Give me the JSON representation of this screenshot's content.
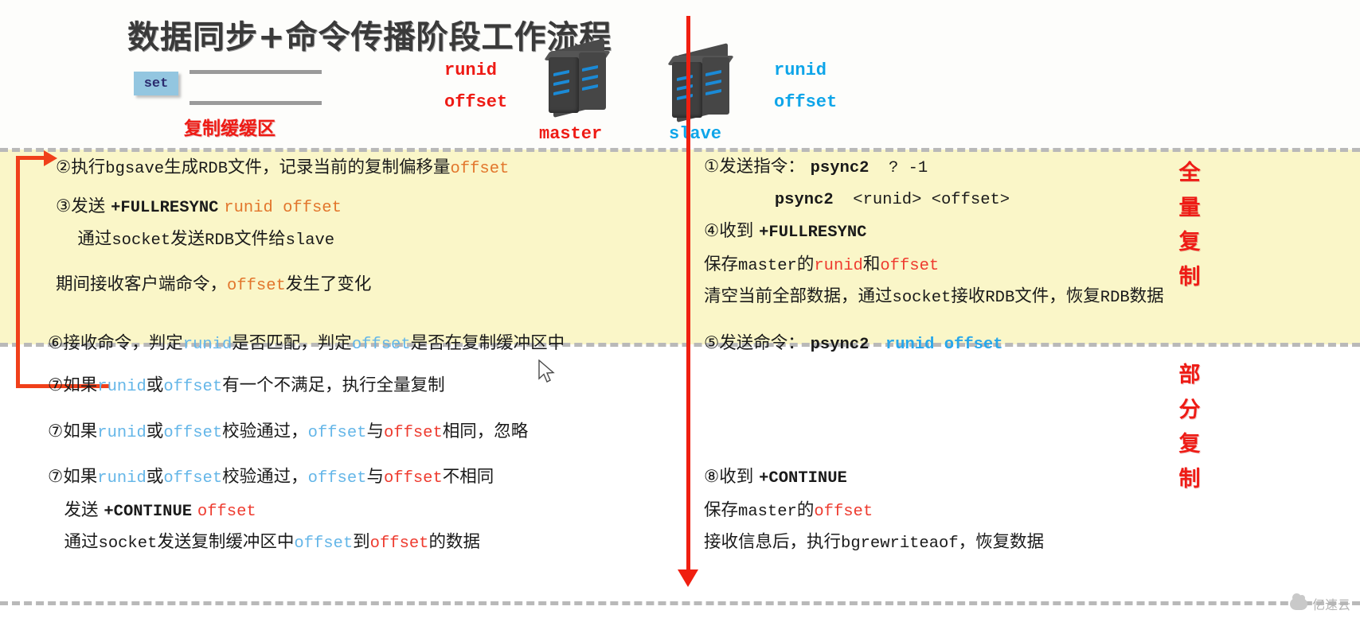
{
  "header": {
    "title": "数据同步+命令传播阶段工作流程",
    "set_label": "set",
    "buffer_label": "复制缓缓区",
    "master": {
      "runid": "runid",
      "offset": "offset",
      "name": "master"
    },
    "slave": {
      "runid": "runid",
      "offset": "offset",
      "name": "slave"
    }
  },
  "full_sync": {
    "side_label": "全 量 复 制",
    "master_steps": [
      {
        "parts": [
          {
            "t": "②执行",
            "c": "plain"
          },
          {
            "t": "bgsave",
            "c": "mono"
          },
          {
            "t": "生成",
            "c": "plain"
          },
          {
            "t": "RDB",
            "c": "mono"
          },
          {
            "t": "文件，记录当前的复制偏移量",
            "c": "plain"
          },
          {
            "t": "offset",
            "c": "mono-or"
          }
        ]
      },
      {
        "parts": [
          {
            "t": "③发送 ",
            "c": "plain"
          },
          {
            "t": "+FULLRESYNC",
            "c": "mono-bold"
          },
          {
            "t": " ",
            "c": "plain"
          },
          {
            "t": "runid offset",
            "c": "mono-or"
          }
        ]
      },
      {
        "parts": [
          {
            "t": "    通过",
            "c": "plain"
          },
          {
            "t": "socket",
            "c": "mono"
          },
          {
            "t": "发送",
            "c": "plain"
          },
          {
            "t": "RDB",
            "c": "mono"
          },
          {
            "t": "文件给",
            "c": "plain"
          },
          {
            "t": "slave",
            "c": "mono"
          }
        ]
      },
      {
        "parts": [
          {
            "t": "期间接收客户端命令，",
            "c": "plain"
          },
          {
            "t": "offset",
            "c": "mono-or"
          },
          {
            "t": "发生了变化",
            "c": "plain"
          }
        ]
      }
    ],
    "slave_steps": [
      {
        "parts": [
          {
            "t": "①发送指令： ",
            "c": "plain"
          },
          {
            "t": "psync2",
            "c": "mono-bold"
          },
          {
            "t": "  ? -1",
            "c": "mono"
          }
        ]
      },
      {
        "parts": [
          {
            "t": "             ",
            "c": "plain"
          },
          {
            "t": "psync2",
            "c": "mono-bold"
          },
          {
            "t": "  <runid> <offset>",
            "c": "mono"
          }
        ]
      },
      {
        "parts": [
          {
            "t": "④收到 ",
            "c": "plain"
          },
          {
            "t": "+FULLRESYNC",
            "c": "mono-bold"
          }
        ]
      },
      {
        "parts": [
          {
            "t": "保存",
            "c": "plain"
          },
          {
            "t": "master",
            "c": "mono"
          },
          {
            "t": "的",
            "c": "plain"
          },
          {
            "t": "runid",
            "c": "mono-rd"
          },
          {
            "t": "和",
            "c": "plain"
          },
          {
            "t": "offset",
            "c": "mono-rd"
          }
        ]
      },
      {
        "parts": [
          {
            "t": "清空当前全部数据，通过",
            "c": "plain"
          },
          {
            "t": "socket",
            "c": "mono"
          },
          {
            "t": "接收",
            "c": "plain"
          },
          {
            "t": "RDB",
            "c": "mono"
          },
          {
            "t": "文件，恢复",
            "c": "plain"
          },
          {
            "t": "RDB",
            "c": "mono"
          },
          {
            "t": "数据",
            "c": "plain"
          }
        ]
      }
    ]
  },
  "partial_sync": {
    "side_label": "部 分 复 制",
    "master_steps": [
      {
        "parts": [
          {
            "t": "⑥接收命令，判定",
            "c": "plain"
          },
          {
            "t": "runid",
            "c": "mono-bl"
          },
          {
            "t": "是否匹配，判定",
            "c": "plain"
          },
          {
            "t": "offset",
            "c": "mono-bl"
          },
          {
            "t": "是否在复制缓冲区中",
            "c": "plain"
          }
        ]
      },
      {
        "parts": [
          {
            "t": "⑦如果",
            "c": "plain"
          },
          {
            "t": "runid",
            "c": "mono-bl"
          },
          {
            "t": "或",
            "c": "plain"
          },
          {
            "t": "offset",
            "c": "mono-bl"
          },
          {
            "t": "有一个不满足，执行全量复制",
            "c": "plain"
          }
        ]
      },
      {
        "parts": [
          {
            "t": "⑦如果",
            "c": "plain"
          },
          {
            "t": "runid",
            "c": "mono-bl"
          },
          {
            "t": "或",
            "c": "plain"
          },
          {
            "t": "offset",
            "c": "mono-bl"
          },
          {
            "t": "校验通过，",
            "c": "plain"
          },
          {
            "t": "offset",
            "c": "mono-bl"
          },
          {
            "t": "与",
            "c": "plain"
          },
          {
            "t": "offset",
            "c": "mono-rd"
          },
          {
            "t": "相同，忽略",
            "c": "plain"
          }
        ]
      },
      {
        "parts": [
          {
            "t": "⑦如果",
            "c": "plain"
          },
          {
            "t": "runid",
            "c": "mono-bl"
          },
          {
            "t": "或",
            "c": "plain"
          },
          {
            "t": "offset",
            "c": "mono-bl"
          },
          {
            "t": "校验通过，",
            "c": "plain"
          },
          {
            "t": "offset",
            "c": "mono-bl"
          },
          {
            "t": "与",
            "c": "plain"
          },
          {
            "t": "offset",
            "c": "mono-rd"
          },
          {
            "t": "不相同",
            "c": "plain"
          }
        ]
      },
      {
        "parts": [
          {
            "t": "   发送 ",
            "c": "plain"
          },
          {
            "t": "+CONTINUE",
            "c": "mono-bold"
          },
          {
            "t": " ",
            "c": "plain"
          },
          {
            "t": "offset",
            "c": "mono-rd"
          }
        ]
      },
      {
        "parts": [
          {
            "t": "   通过",
            "c": "plain"
          },
          {
            "t": "socket",
            "c": "mono"
          },
          {
            "t": "发送复制缓冲区中",
            "c": "plain"
          },
          {
            "t": "offset",
            "c": "mono-bl"
          },
          {
            "t": "到",
            "c": "plain"
          },
          {
            "t": "offset",
            "c": "mono-rd"
          },
          {
            "t": "的数据",
            "c": "plain"
          }
        ]
      }
    ],
    "slave_steps": [
      {
        "parts": [
          {
            "t": "⑤发送命令： ",
            "c": "plain"
          },
          {
            "t": "psync2",
            "c": "mono-bold"
          },
          {
            "t": "   ",
            "c": "plain"
          },
          {
            "t": "runid offset",
            "c": "mono-bl2"
          }
        ]
      },
      {
        "parts": [
          {
            "t": "⑧收到 ",
            "c": "plain"
          },
          {
            "t": "+CONTINUE",
            "c": "mono-bold"
          }
        ]
      },
      {
        "parts": [
          {
            "t": "保存",
            "c": "plain"
          },
          {
            "t": "master",
            "c": "mono"
          },
          {
            "t": "的",
            "c": "plain"
          },
          {
            "t": "offset",
            "c": "mono-rd"
          }
        ]
      },
      {
        "parts": [
          {
            "t": "接收信息后，执行",
            "c": "plain"
          },
          {
            "t": "bgrewriteaof",
            "c": "mono"
          },
          {
            "t": "，恢复数据",
            "c": "plain"
          }
        ]
      }
    ]
  },
  "watermark": {
    "text": "亿速云"
  },
  "colors": {
    "band_yellow": "#faf6c8",
    "divider_red": "#f01f10",
    "accent_orange": "#e2762c",
    "accent_red": "#ee3b2f",
    "accent_blue": "#64b6e8",
    "set_badge_bg": "#93c6e0"
  }
}
